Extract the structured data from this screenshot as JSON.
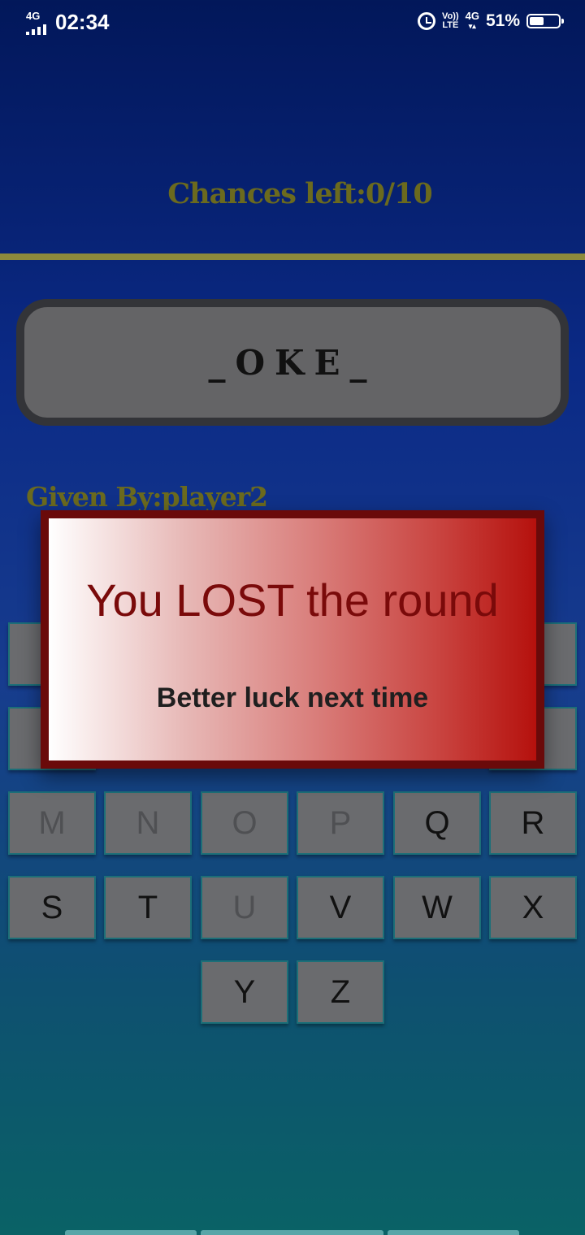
{
  "status_bar": {
    "network": "4G",
    "time": "02:34",
    "volte_top": "Vo))",
    "volte_bottom": "LTE",
    "network_right": "4G",
    "battery_percent_text": "51%",
    "battery_level": 0.51
  },
  "game": {
    "chances_text": "Chances left:0/10",
    "word_display": "_OKE_",
    "given_by_text": "Given By:player2"
  },
  "keyboard": {
    "keys": [
      {
        "letter": "M",
        "disabled": true
      },
      {
        "letter": "N",
        "disabled": true
      },
      {
        "letter": "O",
        "disabled": true
      },
      {
        "letter": "P",
        "disabled": true
      },
      {
        "letter": "Q",
        "disabled": false
      },
      {
        "letter": "R",
        "disabled": false
      },
      {
        "letter": "S",
        "disabled": false
      },
      {
        "letter": "T",
        "disabled": false
      },
      {
        "letter": "U",
        "disabled": true
      },
      {
        "letter": "V",
        "disabled": false
      },
      {
        "letter": "W",
        "disabled": false
      },
      {
        "letter": "X",
        "disabled": false
      },
      {
        "letter": "Y",
        "disabled": false
      },
      {
        "letter": "Z",
        "disabled": false
      }
    ]
  },
  "dialog": {
    "title": "You LOST the round",
    "message": "Better luck next time"
  }
}
